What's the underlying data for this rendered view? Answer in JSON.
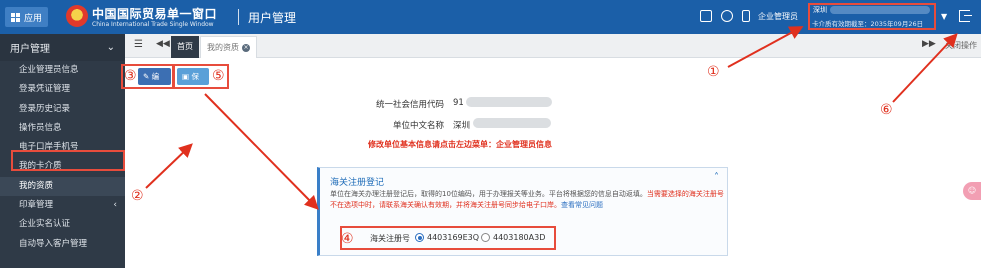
{
  "header": {
    "app_button": "应用",
    "brand_title": "中国国际贸易单一窗口",
    "brand_subtitle": "China International Trade Single Window",
    "page_title": "用户管理",
    "user_name": "企业管理员",
    "user_city": "深圳",
    "card_expiry": "卡介质有效期截至：2035年09月26日"
  },
  "sidebar": {
    "title": "用户管理",
    "items": [
      {
        "label": "企业管理员信息"
      },
      {
        "label": "登录凭证管理"
      },
      {
        "label": "登录历史记录"
      },
      {
        "label": "操作员信息"
      },
      {
        "label": "电子口岸手机号"
      },
      {
        "label": "我的卡介质"
      },
      {
        "label": "我的资质"
      },
      {
        "label": "印章管理"
      },
      {
        "label": "企业实名认证"
      },
      {
        "label": "自动导入客户管理"
      }
    ]
  },
  "tabs": {
    "home": "首页",
    "current": "我的资质",
    "close_ops": "关闭操作"
  },
  "toolbar": {
    "edit": "编辑",
    "save": "保存"
  },
  "form": {
    "credit_code_label": "统一社会信用代码",
    "credit_code_value": "91",
    "name_label": "单位中文名称",
    "name_value": "深圳",
    "notice": "修改单位基本信息请点击左边菜单：企业管理员信息"
  },
  "customs": {
    "title": "海关注册登记",
    "desc_normal": "单位在海关办理注册登记后，取得的10位编码，用于办理报关等业务。平台将根据您的信息自动返填。",
    "desc_warn": "当需要选择的海关注册号不在选项中时，请联系海关确认有效期，并将海关注册号同步给电子口岸。",
    "desc_link": "查看常见问题",
    "reg_label": "海关注册号",
    "options": [
      {
        "value": "4403169E3Q",
        "selected": true
      },
      {
        "value": "4403180A3D",
        "selected": false
      }
    ]
  },
  "annotations": [
    "①",
    "②",
    "③",
    "④",
    "⑤",
    "⑥"
  ],
  "colors": {
    "header_bg": "#1b5fa8",
    "sidebar_bg": "#2f3a47",
    "highlight_red": "#e74c3c",
    "accent_blue": "#2a6ec0"
  }
}
